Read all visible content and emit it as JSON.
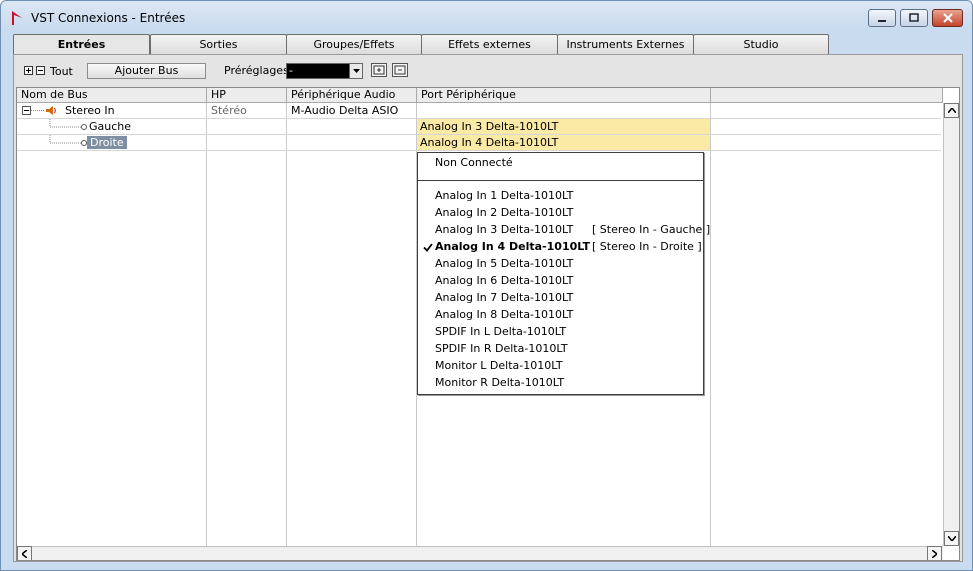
{
  "window": {
    "title": "VST Connexions - Entrées",
    "brand_color": "#c8102e"
  },
  "tabs": [
    {
      "label": "Entrées",
      "active": true
    },
    {
      "label": "Sorties"
    },
    {
      "label": "Groupes/Effets"
    },
    {
      "label": "Effets externes"
    },
    {
      "label": "Instruments Externes"
    },
    {
      "label": "Studio"
    }
  ],
  "toolbar": {
    "tout_label": "Tout",
    "add_bus_label": "Ajouter Bus",
    "presets_label": "Préréglages",
    "presets_value": "-"
  },
  "table": {
    "columns": [
      "Nom de Bus",
      "HP",
      "Périphérique Audio",
      "Port Périphérique"
    ],
    "rows": [
      {
        "name": "Stereo In",
        "hp": "Stéréo",
        "device": "M-Audio Delta ASIO",
        "port": ""
      },
      {
        "name": "Gauche",
        "hp": "",
        "device": "",
        "port": "Analog In 3 Delta-1010LT"
      },
      {
        "name": "Droite",
        "hp": "",
        "device": "",
        "port": "Analog In 4 Delta-1010LT"
      }
    ],
    "port_highlight_color": "#fbe9a6"
  },
  "dropdown": {
    "not_connected": "Non Connecté",
    "items": [
      {
        "label": "Analog In 1 Delta-1010LT",
        "note": ""
      },
      {
        "label": "Analog In 2 Delta-1010LT",
        "note": ""
      },
      {
        "label": "Analog In 3 Delta-1010LT",
        "note": "[ Stereo In - Gauche ]"
      },
      {
        "label": "Analog In 4 Delta-1010LT",
        "note": "[ Stereo In - Droite ]",
        "checked": true
      },
      {
        "label": "Analog In 5 Delta-1010LT",
        "note": ""
      },
      {
        "label": "Analog In 6 Delta-1010LT",
        "note": ""
      },
      {
        "label": "Analog In 7 Delta-1010LT",
        "note": ""
      },
      {
        "label": "Analog In 8 Delta-1010LT",
        "note": ""
      },
      {
        "label": "SPDIF In L Delta-1010LT",
        "note": ""
      },
      {
        "label": "SPDIF In R Delta-1010LT",
        "note": ""
      },
      {
        "label": "Monitor L Delta-1010LT",
        "note": ""
      },
      {
        "label": "Monitor R Delta-1010LT",
        "note": ""
      }
    ]
  }
}
